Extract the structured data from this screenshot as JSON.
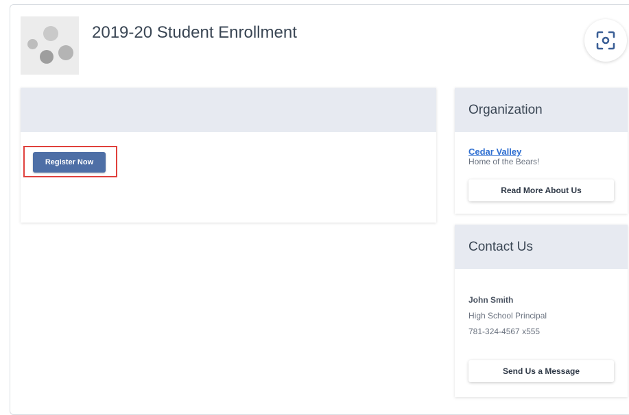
{
  "header": {
    "title": "2019-20 Student Enrollment"
  },
  "main": {
    "register_label": "Register Now"
  },
  "organization": {
    "heading": "Organization",
    "name": "Cedar Valley",
    "tagline": "Home of the Bears!",
    "button_label": "Read More About Us"
  },
  "contact": {
    "heading": "Contact Us",
    "name": "John Smith",
    "role": "High School Principal",
    "phone": "781-324-4567 x555",
    "button_label": "Send Us a Message"
  },
  "icons": {
    "logo": "organization-logo",
    "scan": "scan-icon"
  },
  "colors": {
    "accent": "#4e6fa6",
    "highlight": "#e0403c",
    "link": "#2f6fd1",
    "panel_header": "#e7eaf1"
  }
}
